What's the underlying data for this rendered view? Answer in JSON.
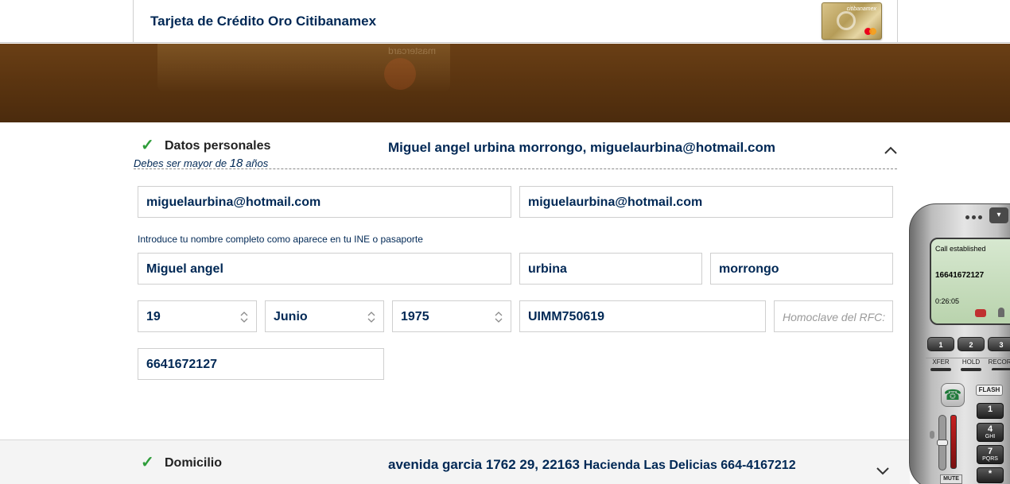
{
  "header": {
    "title": "Tarjeta de Crédito Oro Citibanamex",
    "card_brand": "citibanamex"
  },
  "banner": {
    "faded_text": "mastercard"
  },
  "personal": {
    "section_label": "Datos personales",
    "summary": "Miguel angel urbina morrongo, miguelaurbina@hotmail.com",
    "age_note_prefix": "Debes ser mayor de",
    "age_note_number": "18",
    "age_note_suffix": "años",
    "email": "miguelaurbina@hotmail.com",
    "email_confirm": "miguelaurbina@hotmail.com",
    "name_hint": "Introduce tu nombre completo como aparece en tu INE o pasaporte",
    "first_name": "Miguel angel",
    "last_name_1": "urbina",
    "last_name_2": "morrongo",
    "birth_day": "19",
    "birth_month": "Junio",
    "birth_year": "1975",
    "rfc": "UIMM750619",
    "homoclave_placeholder": "Homoclave del RFC:",
    "phone": "6641672127"
  },
  "address": {
    "section_label": "Domicilio",
    "summary_main": "avenida garcia 1762 29, 22163",
    "summary_rest": "Hacienda Las Delicias 664-4167212"
  },
  "softphone": {
    "status": "Call established",
    "number": "16641672127",
    "timer": "0:26:05",
    "menu_glyph": "▾",
    "line_buttons": [
      "1",
      "2",
      "3"
    ],
    "func_buttons": [
      "XFER",
      "HOLD",
      "RECORD"
    ],
    "flash_label": "FLASH",
    "keys": [
      {
        "digit": "1",
        "letters": ""
      },
      {
        "digit": "4",
        "letters": "GHI"
      },
      {
        "digit": "7",
        "letters": "PQRS"
      },
      {
        "digit": "*",
        "letters": ""
      }
    ],
    "mute_label": "MUTE",
    "call_glyph": "☎"
  },
  "colors": {
    "brand_navy": "#002855",
    "check_green": "#2e9d3a",
    "banner_brown": "#5a3410"
  }
}
